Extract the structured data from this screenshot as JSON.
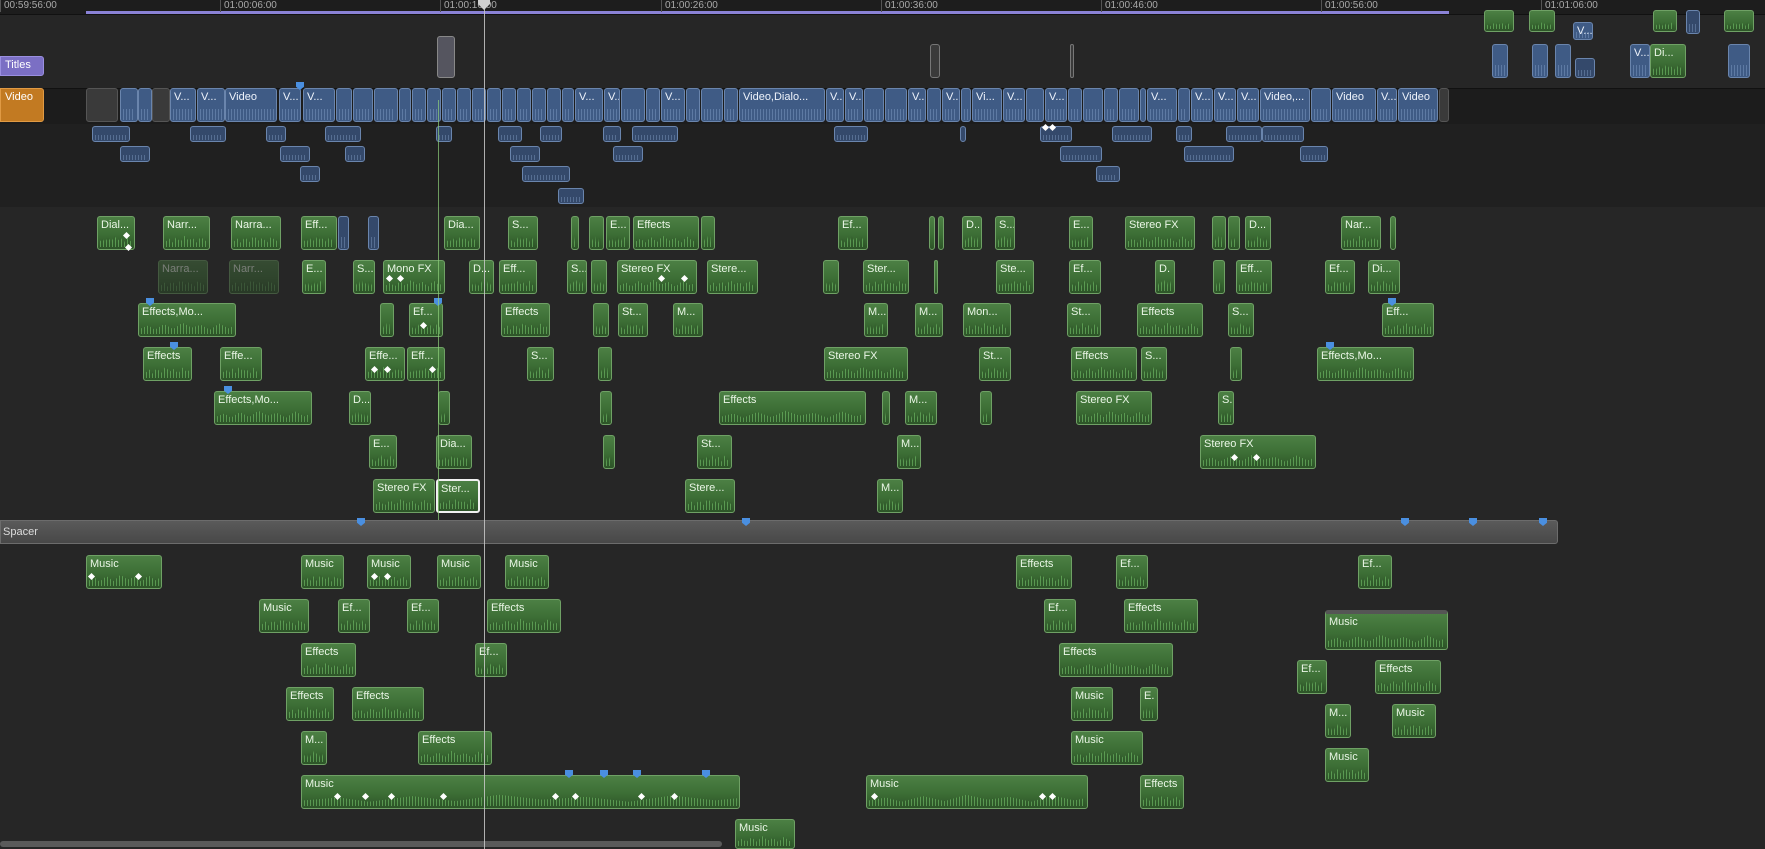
{
  "ruler": {
    "timecodes": [
      "00:59:56:00",
      "01:00:06:00",
      "01:00:16:00",
      "01:00:26:00",
      "01:00:36:00",
      "01:00:46:00",
      "01:00:56:00",
      "01:01:06:00"
    ]
  },
  "roles": {
    "titles_label": "Titles",
    "video_label": "Video",
    "spacer_label": "Spacer"
  },
  "colors": {
    "titles_role": "#7b6fc4",
    "video_role": "#c27a22",
    "audio_clip": "#3f7438",
    "video_clip": "#3f5b85",
    "marker": "#4a8fe0"
  },
  "icons": {
    "marker": "blue-marker-icon",
    "keyframe": "white-keyframe-diamond-icon",
    "playhead": "playhead-icon"
  },
  "primary_storyline_labels": [
    "V...",
    "V...",
    "Video",
    "V...",
    "V...",
    "V...",
    "V...",
    "V...",
    "Video,Dialo...",
    "V...",
    "V...",
    "V...",
    "V...",
    "Vi...",
    "V...",
    "V...",
    "V...",
    "V...",
    "V...",
    "V...",
    "Video,...",
    "Video",
    "V...",
    "Video"
  ],
  "audio_labels": {
    "row1": [
      "Dial...",
      "Narr...",
      "Narra...",
      "Eff...",
      "Dia...",
      "S...",
      "E...",
      "Effects",
      "Ef...",
      "D...",
      "S...",
      "E...",
      "Stereo FX",
      "D...",
      "Nar..."
    ],
    "row2": [
      "Narra...",
      "Narr...",
      "E...",
      "S...",
      "Mono FX",
      "D...",
      "Eff...",
      "S...",
      "Stereo FX",
      "Stere...",
      "Ster...",
      "Ste...",
      "Ef...",
      "D.",
      "Eff...",
      "Ef...",
      "Di..."
    ],
    "row3": [
      "Effects,Mo...",
      "Ef...",
      "Effects",
      "St...",
      "M...",
      "M...",
      "M...",
      "Mon...",
      "St...",
      "Effects",
      "S...",
      "Eff..."
    ],
    "row4": [
      "Effects",
      "Effe...",
      "Effe...",
      "Eff...",
      "S...",
      "Stereo FX",
      "St...",
      "Effects",
      "S...",
      "Effects,Mo..."
    ],
    "row5": [
      "Effects,Mo...",
      "D...",
      "Effects",
      "M...",
      "Stereo FX",
      "S."
    ],
    "row6": [
      "E...",
      "Dia...",
      "St...",
      "M...",
      "Stereo FX"
    ],
    "row7": [
      "Stereo FX",
      "Ster...",
      "Stere...",
      "M..."
    ],
    "music1": [
      "Music",
      "Music",
      "Music",
      "Music",
      "Music",
      "Effects",
      "Ef...",
      "Ef..."
    ],
    "music2": [
      "Music",
      "Ef...",
      "Ef...",
      "Effects",
      "Ef...",
      "Effects"
    ],
    "music3": [
      "Effects",
      "Ef...",
      "Effects"
    ],
    "music4": [
      "Effects",
      "Effects",
      "Music",
      "E."
    ],
    "music5": [
      "M...",
      "Effects",
      "Music"
    ],
    "music6": [
      "Music",
      "Music",
      "Effects"
    ],
    "music7": [
      "Music"
    ],
    "right_group": [
      "Music",
      "Ef...",
      "Effects",
      "M...",
      "Music",
      "Music"
    ],
    "top_right": [
      "V...",
      "V...",
      "Di..."
    ]
  }
}
